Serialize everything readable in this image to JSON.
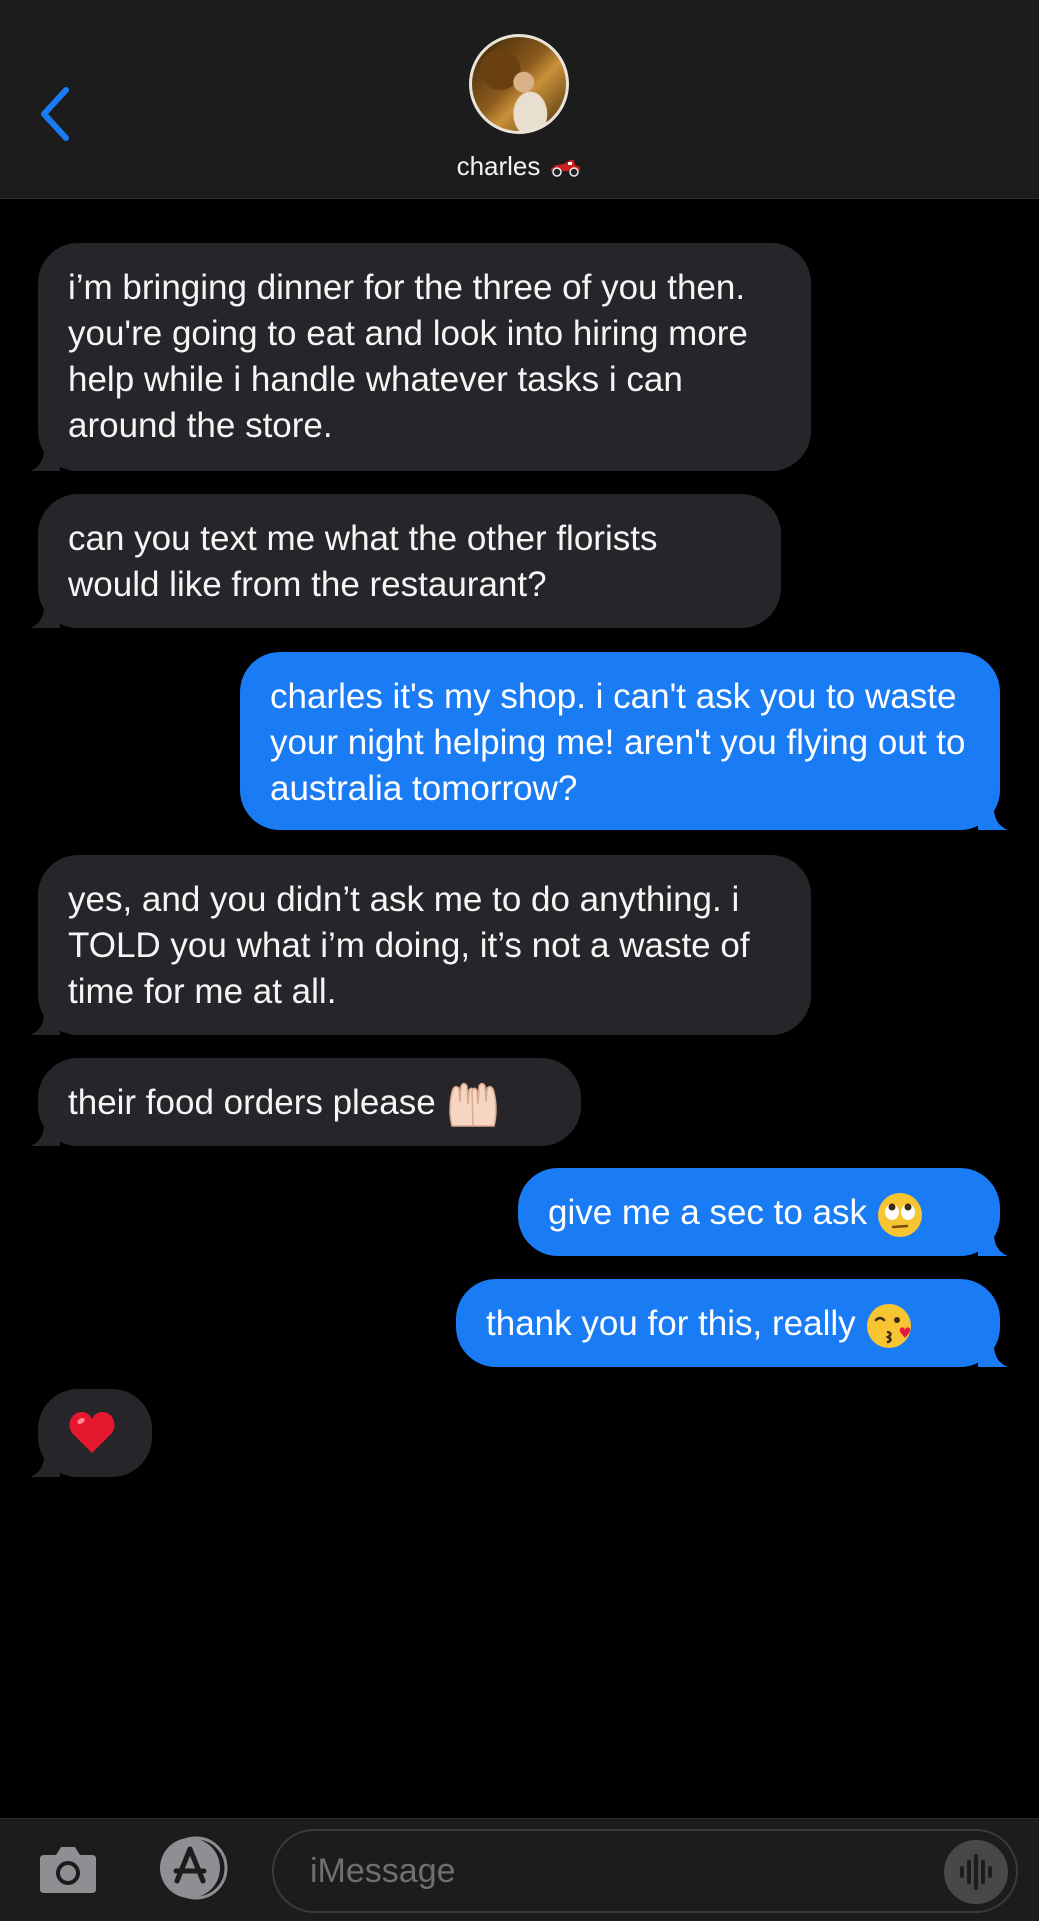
{
  "header": {
    "contact_name": "charles",
    "back_icon": "chevron-left-icon",
    "accent_color": "#1a7cf5"
  },
  "messages": [
    {
      "direction": "incoming",
      "text": "i’m bringing dinner for the three of you then. you're going to eat and look into hiring more help while i handle whatever tasks i can around the store."
    },
    {
      "direction": "incoming",
      "text": "can you text me what the other florists would like from the restaurant?"
    },
    {
      "direction": "outgoing",
      "text": "charles it's my shop. i can't ask you to waste your night helping me! aren't you flying out to australia tomorrow?"
    },
    {
      "direction": "incoming",
      "text": "yes, and you didn’t ask me to do anything. i TOLD you what i’m doing, it’s not a waste of time for me at all."
    },
    {
      "direction": "incoming",
      "text": "their food orders please",
      "emoji": "raising-hands-emoji"
    },
    {
      "direction": "outgoing",
      "text": "give me a sec to ask",
      "emoji": "eye-roll-emoji"
    },
    {
      "direction": "outgoing",
      "text": "thank you for this, really",
      "emoji": "kiss-emoji"
    },
    {
      "direction": "incoming",
      "text": "",
      "emoji": "red-heart-emoji"
    }
  ],
  "composer": {
    "placeholder": "iMessage",
    "camera_icon": "camera-icon",
    "apps_icon": "app-store-icon",
    "audio_icon": "audio-waveform-icon"
  },
  "colors": {
    "incoming_bubble": "#26252a",
    "outgoing_bubble": "#1a7cf5",
    "background": "#000000",
    "bar": "#1c1c1d"
  }
}
